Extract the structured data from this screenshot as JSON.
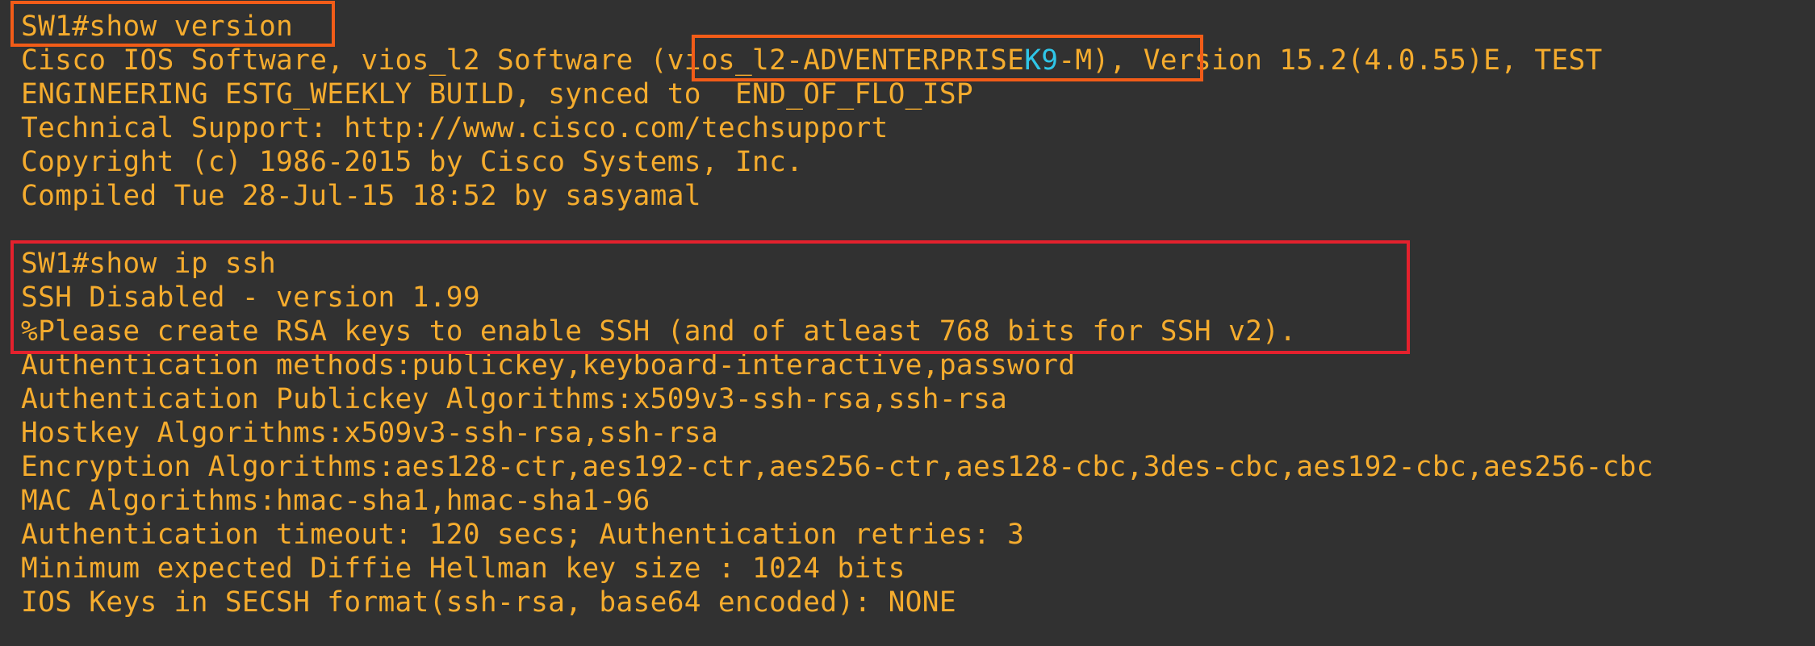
{
  "terminal": {
    "line1": "SW1#show version",
    "line2": {
      "pre": "Cisco IOS Software, vios_l2 Software ",
      "image_a": "(vios_l2-ADVENTERPRISE",
      "image_k9": "K9",
      "image_b": "-M)",
      "post": ", Version 15.2(4.0.55)E, TEST"
    },
    "line3": "ENGINEERING ESTG_WEEKLY BUILD, synced to  END_OF_FLO_ISP",
    "line4": "Technical Support: http://www.cisco.com/techsupport",
    "line5": "Copyright (c) 1986-2015 by Cisco Systems, Inc.",
    "line6": "Compiled Tue 28-Jul-15 18:52 by sasyamal",
    "line7": "SW1#show ip ssh",
    "line8": "SSH Disabled - version 1.99",
    "line9": "%Please create RSA keys to enable SSH (and of atleast 768 bits for SSH v2).",
    "line10": "Authentication methods:publickey,keyboard-interactive,password",
    "line11": "Authentication Publickey Algorithms:x509v3-ssh-rsa,ssh-rsa",
    "line12": "Hostkey Algorithms:x509v3-ssh-rsa,ssh-rsa",
    "line13": "Encryption Algorithms:aes128-ctr,aes192-ctr,aes256-ctr,aes128-cbc,3des-cbc,aes192-cbc,aes256-cbc",
    "line14": "MAC Algorithms:hmac-sha1,hmac-sha1-96",
    "line15": "Authentication timeout: 120 secs; Authentication retries: 3",
    "line16": "Minimum expected Diffie Hellman key size : 1024 bits",
    "line17": "IOS Keys in SECSH format(ssh-rsa, base64 encoded): NONE"
  },
  "colors": {
    "background": "#313131",
    "text": "#f5ac2e",
    "highlight_k9": "#2fc6e8",
    "box_orange": "#f25c18",
    "box_red": "#e4212d"
  }
}
